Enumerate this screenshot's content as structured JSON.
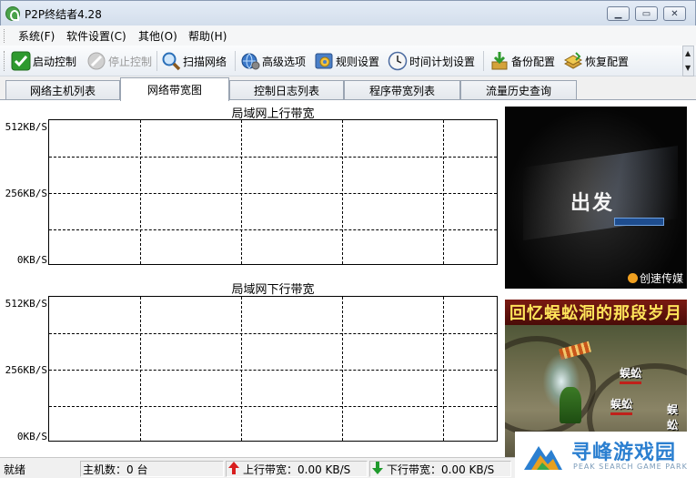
{
  "window": {
    "title": "P2P终结者4.28"
  },
  "menu": [
    {
      "label": "系统(F)"
    },
    {
      "label": "软件设置(C)"
    },
    {
      "label": "其他(O)"
    },
    {
      "label": "帮助(H)"
    }
  ],
  "toolbar": {
    "start": "启动控制",
    "stop": "停止控制",
    "scan": "扫描网络",
    "advanced": "高级选项",
    "rules": "规则设置",
    "schedule": "时间计划设置",
    "backup": "备份配置",
    "restore": "恢复配置"
  },
  "tabs": [
    {
      "label": "网络主机列表",
      "active": false
    },
    {
      "label": "网络带宽图",
      "active": true
    },
    {
      "label": "控制日志列表",
      "active": false
    },
    {
      "label": "程序带宽列表",
      "active": false
    },
    {
      "label": "流量历史查询",
      "active": false
    }
  ],
  "graphs": {
    "upload": {
      "title": "局域网上行带宽",
      "y_ticks": [
        "512KB/S",
        "256KB/S",
        "0KB/S"
      ]
    },
    "download": {
      "title": "局域网下行带宽",
      "y_ticks": [
        "512KB/S",
        "256KB/S",
        "0KB/S"
      ]
    }
  },
  "ads": {
    "ad1": {
      "headline": "出发",
      "brand": "创速传媒"
    },
    "ad2": {
      "banner": "回忆蜈蚣洞的那段岁月",
      "labels": [
        "蜈蚣",
        "蜈蚣",
        "蜈蚣"
      ]
    }
  },
  "status": {
    "ready": "就绪",
    "hosts": "主机数：0 台",
    "upload": "上行带宽：0.00 KB/S",
    "download": "下行带宽：0.00 KB/S"
  },
  "watermark": {
    "cn": "寻峰游戏园",
    "en": "PEAK SEARCH GAME PARK"
  },
  "colors": {
    "upload_arrow": "#d81e1e",
    "download_arrow": "#1f9a2c",
    "tab_border": "#9aa4b2"
  }
}
